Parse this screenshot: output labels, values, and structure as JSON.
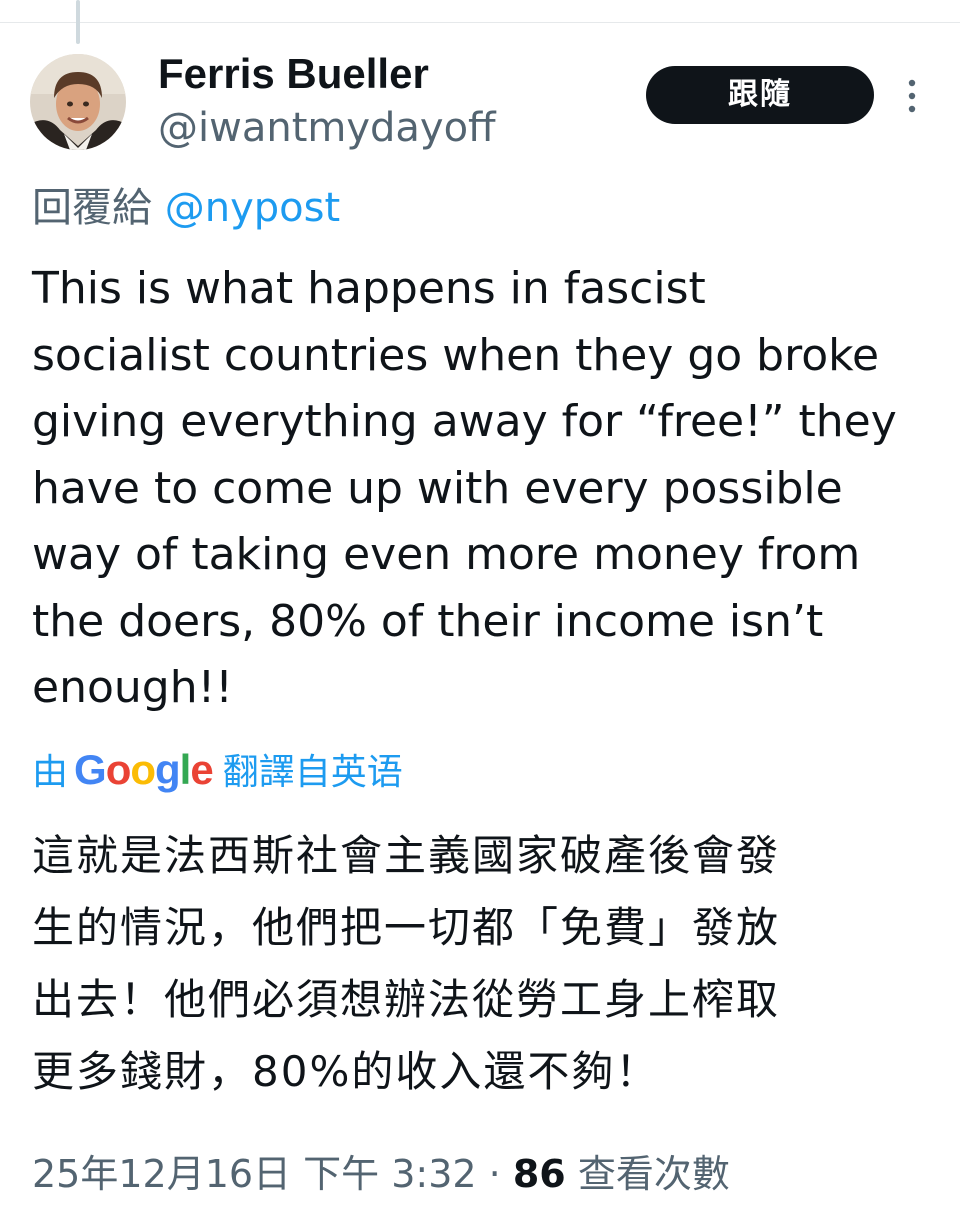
{
  "author": {
    "display_name": "Ferris Bueller",
    "handle": "@iwantmydayoff"
  },
  "follow_button_label": "跟隨",
  "more_icon": "more-vertical-icon",
  "reply_context": {
    "prefix": "回覆給",
    "mention": "@nypost"
  },
  "tweet_lines": [
    "This is what happens in fascist",
    "socialist countries when they go broke",
    "giving everything away for “free!” they",
    "have to come up with every possible",
    "way of taking even more money from",
    "the doers, 80% of their income isn’t",
    "enough!!"
  ],
  "translation": {
    "by": "由",
    "provider": "Google",
    "suffix": "翻譯自英语",
    "lines": [
      "這就是法西斯社會主義國家破產後會發",
      "生的情況，他們把一切都「免費」發放",
      "出去！他們必須想辦法從勞工身上榨取",
      "更多錢財，80%的收入還不夠！"
    ]
  },
  "meta": {
    "timestamp": "25年12月16日 下午 3:32",
    "separator": "·",
    "view_count": "86",
    "views_label": "查看次數"
  },
  "colors": {
    "text_primary": "#0f1419",
    "text_secondary": "#536471",
    "link_blue": "#1d9bf0",
    "button_bg": "#0f1419"
  }
}
